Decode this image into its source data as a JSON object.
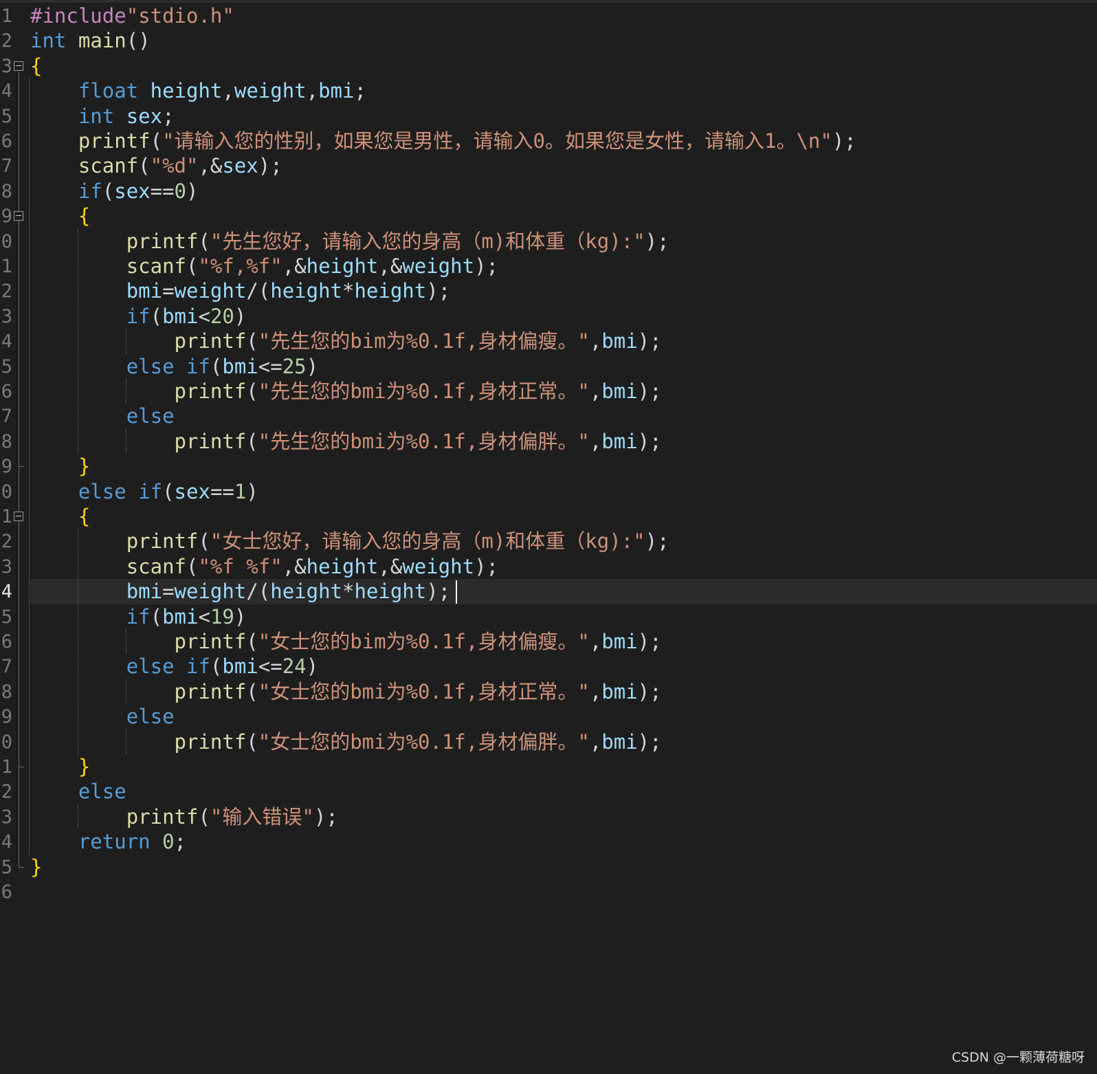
{
  "editor": {
    "current_line": 24,
    "lines": [
      {
        "num": "1",
        "tokens": [
          [
            "pp",
            "#include"
          ],
          [
            "str",
            "\"stdio.h\""
          ]
        ]
      },
      {
        "num": "2",
        "tokens": [
          [
            "kw",
            "int"
          ],
          [
            "pn",
            " "
          ],
          [
            "fn",
            "main"
          ],
          [
            "pn",
            "()"
          ]
        ]
      },
      {
        "num": "3",
        "tokens": [
          [
            "br",
            "{"
          ]
        ]
      },
      {
        "num": "4",
        "tokens": [
          [
            "pn",
            "    "
          ],
          [
            "kw",
            "float"
          ],
          [
            "pn",
            " "
          ],
          [
            "id",
            "height"
          ],
          [
            "pn",
            ","
          ],
          [
            "id",
            "weight"
          ],
          [
            "pn",
            ","
          ],
          [
            "id",
            "bmi"
          ],
          [
            "pn",
            ";"
          ]
        ]
      },
      {
        "num": "5",
        "tokens": [
          [
            "pn",
            "    "
          ],
          [
            "kw",
            "int"
          ],
          [
            "pn",
            " "
          ],
          [
            "id",
            "sex"
          ],
          [
            "pn",
            ";"
          ]
        ]
      },
      {
        "num": "6",
        "tokens": [
          [
            "pn",
            "    "
          ],
          [
            "fn",
            "printf"
          ],
          [
            "pn",
            "("
          ],
          [
            "str",
            "\"请输入您的性别，如果您是男性，请输入0。如果您是女性，请输入1。\\n\""
          ],
          [
            "pn",
            ");"
          ]
        ]
      },
      {
        "num": "7",
        "tokens": [
          [
            "pn",
            "    "
          ],
          [
            "fn",
            "scanf"
          ],
          [
            "pn",
            "("
          ],
          [
            "str",
            "\"%d\""
          ],
          [
            "pn",
            ",&"
          ],
          [
            "id",
            "sex"
          ],
          [
            "pn",
            ");"
          ]
        ]
      },
      {
        "num": "8",
        "tokens": [
          [
            "pn",
            "    "
          ],
          [
            "kw",
            "if"
          ],
          [
            "pn",
            "("
          ],
          [
            "id",
            "sex"
          ],
          [
            "pn",
            "=="
          ],
          [
            "num",
            "0"
          ],
          [
            "pn",
            ")"
          ]
        ]
      },
      {
        "num": "9",
        "tokens": [
          [
            "pn",
            "    "
          ],
          [
            "br",
            "{"
          ]
        ]
      },
      {
        "num": "0",
        "tokens": [
          [
            "pn",
            "        "
          ],
          [
            "fn",
            "printf"
          ],
          [
            "pn",
            "("
          ],
          [
            "str",
            "\"先生您好，请输入您的身高（m)和体重（kg):\""
          ],
          [
            "pn",
            ");"
          ]
        ]
      },
      {
        "num": "1",
        "tokens": [
          [
            "pn",
            "        "
          ],
          [
            "fn",
            "scanf"
          ],
          [
            "pn",
            "("
          ],
          [
            "str",
            "\"%f,%f\""
          ],
          [
            "pn",
            ",&"
          ],
          [
            "id",
            "height"
          ],
          [
            "pn",
            ",&"
          ],
          [
            "id",
            "weight"
          ],
          [
            "pn",
            ");"
          ]
        ]
      },
      {
        "num": "2",
        "tokens": [
          [
            "pn",
            "        "
          ],
          [
            "id",
            "bmi"
          ],
          [
            "pn",
            "="
          ],
          [
            "id",
            "weight"
          ],
          [
            "pn",
            "/("
          ],
          [
            "id",
            "height"
          ],
          [
            "pn",
            "*"
          ],
          [
            "id",
            "height"
          ],
          [
            "pn",
            ");"
          ]
        ]
      },
      {
        "num": "3",
        "tokens": [
          [
            "pn",
            "        "
          ],
          [
            "kw",
            "if"
          ],
          [
            "pn",
            "("
          ],
          [
            "id",
            "bmi"
          ],
          [
            "pn",
            "<"
          ],
          [
            "num",
            "20"
          ],
          [
            "pn",
            ")"
          ]
        ]
      },
      {
        "num": "4",
        "tokens": [
          [
            "pn",
            "            "
          ],
          [
            "fn",
            "printf"
          ],
          [
            "pn",
            "("
          ],
          [
            "str",
            "\"先生您的bim为%0.1f,身材偏瘦。\""
          ],
          [
            "pn",
            ","
          ],
          [
            "id",
            "bmi"
          ],
          [
            "pn",
            ");"
          ]
        ]
      },
      {
        "num": "5",
        "tokens": [
          [
            "pn",
            "        "
          ],
          [
            "kw",
            "else"
          ],
          [
            "pn",
            " "
          ],
          [
            "kw",
            "if"
          ],
          [
            "pn",
            "("
          ],
          [
            "id",
            "bmi"
          ],
          [
            "pn",
            "<="
          ],
          [
            "num",
            "25"
          ],
          [
            "pn",
            ")"
          ]
        ]
      },
      {
        "num": "6",
        "tokens": [
          [
            "pn",
            "            "
          ],
          [
            "fn",
            "printf"
          ],
          [
            "pn",
            "("
          ],
          [
            "str",
            "\"先生您的bmi为%0.1f,身材正常。\""
          ],
          [
            "pn",
            ","
          ],
          [
            "id",
            "bmi"
          ],
          [
            "pn",
            ");"
          ]
        ]
      },
      {
        "num": "7",
        "tokens": [
          [
            "pn",
            "        "
          ],
          [
            "kw",
            "else"
          ]
        ]
      },
      {
        "num": "8",
        "tokens": [
          [
            "pn",
            "            "
          ],
          [
            "fn",
            "printf"
          ],
          [
            "pn",
            "("
          ],
          [
            "str",
            "\"先生您的bmi为%0.1f,身材偏胖。\""
          ],
          [
            "pn",
            ","
          ],
          [
            "id",
            "bmi"
          ],
          [
            "pn",
            ");"
          ]
        ]
      },
      {
        "num": "9",
        "tokens": [
          [
            "pn",
            "    "
          ],
          [
            "br",
            "}"
          ]
        ]
      },
      {
        "num": "0",
        "tokens": [
          [
            "pn",
            "    "
          ],
          [
            "kw",
            "else"
          ],
          [
            "pn",
            " "
          ],
          [
            "kw",
            "if"
          ],
          [
            "pn",
            "("
          ],
          [
            "id",
            "sex"
          ],
          [
            "pn",
            "=="
          ],
          [
            "num",
            "1"
          ],
          [
            "pn",
            ")"
          ]
        ]
      },
      {
        "num": "1",
        "tokens": [
          [
            "pn",
            "    "
          ],
          [
            "br",
            "{"
          ]
        ]
      },
      {
        "num": "2",
        "tokens": [
          [
            "pn",
            "        "
          ],
          [
            "fn",
            "printf"
          ],
          [
            "pn",
            "("
          ],
          [
            "str",
            "\"女士您好，请输入您的身高（m)和体重（kg):\""
          ],
          [
            "pn",
            ");"
          ]
        ]
      },
      {
        "num": "3",
        "tokens": [
          [
            "pn",
            "        "
          ],
          [
            "fn",
            "scanf"
          ],
          [
            "pn",
            "("
          ],
          [
            "str",
            "\"%f %f\""
          ],
          [
            "pn",
            ",&"
          ],
          [
            "id",
            "height"
          ],
          [
            "pn",
            ",&"
          ],
          [
            "id",
            "weight"
          ],
          [
            "pn",
            ");"
          ]
        ]
      },
      {
        "num": "4",
        "tokens": [
          [
            "pn",
            "        "
          ],
          [
            "id",
            "bmi"
          ],
          [
            "pn",
            "="
          ],
          [
            "id",
            "weight"
          ],
          [
            "pn",
            "/("
          ],
          [
            "id",
            "height"
          ],
          [
            "pn",
            "*"
          ],
          [
            "id",
            "height"
          ],
          [
            "pn",
            ");"
          ]
        ]
      },
      {
        "num": "5",
        "tokens": [
          [
            "pn",
            "        "
          ],
          [
            "kw",
            "if"
          ],
          [
            "pn",
            "("
          ],
          [
            "id",
            "bmi"
          ],
          [
            "pn",
            "<"
          ],
          [
            "num",
            "19"
          ],
          [
            "pn",
            ")"
          ]
        ]
      },
      {
        "num": "6",
        "tokens": [
          [
            "pn",
            "            "
          ],
          [
            "fn",
            "printf"
          ],
          [
            "pn",
            "("
          ],
          [
            "str",
            "\"女士您的bim为%0.1f,身材偏瘦。\""
          ],
          [
            "pn",
            ","
          ],
          [
            "id",
            "bmi"
          ],
          [
            "pn",
            ");"
          ]
        ]
      },
      {
        "num": "7",
        "tokens": [
          [
            "pn",
            "        "
          ],
          [
            "kw",
            "else"
          ],
          [
            "pn",
            " "
          ],
          [
            "kw",
            "if"
          ],
          [
            "pn",
            "("
          ],
          [
            "id",
            "bmi"
          ],
          [
            "pn",
            "<="
          ],
          [
            "num",
            "24"
          ],
          [
            "pn",
            ")"
          ]
        ]
      },
      {
        "num": "8",
        "tokens": [
          [
            "pn",
            "            "
          ],
          [
            "fn",
            "printf"
          ],
          [
            "pn",
            "("
          ],
          [
            "str",
            "\"女士您的bmi为%0.1f,身材正常。\""
          ],
          [
            "pn",
            ","
          ],
          [
            "id",
            "bmi"
          ],
          [
            "pn",
            ");"
          ]
        ]
      },
      {
        "num": "9",
        "tokens": [
          [
            "pn",
            "        "
          ],
          [
            "kw",
            "else"
          ]
        ]
      },
      {
        "num": "0",
        "tokens": [
          [
            "pn",
            "            "
          ],
          [
            "fn",
            "printf"
          ],
          [
            "pn",
            "("
          ],
          [
            "str",
            "\"女士您的bmi为%0.1f,身材偏胖。\""
          ],
          [
            "pn",
            ","
          ],
          [
            "id",
            "bmi"
          ],
          [
            "pn",
            ");"
          ]
        ]
      },
      {
        "num": "1",
        "tokens": [
          [
            "pn",
            "    "
          ],
          [
            "br",
            "}"
          ]
        ]
      },
      {
        "num": "2",
        "tokens": [
          [
            "pn",
            "    "
          ],
          [
            "kw",
            "else"
          ]
        ]
      },
      {
        "num": "3",
        "tokens": [
          [
            "pn",
            "        "
          ],
          [
            "fn",
            "printf"
          ],
          [
            "pn",
            "("
          ],
          [
            "str",
            "\"输入错误\""
          ],
          [
            "pn",
            ");"
          ]
        ]
      },
      {
        "num": "4",
        "tokens": [
          [
            "pn",
            "    "
          ],
          [
            "kw",
            "return"
          ],
          [
            "pn",
            " "
          ],
          [
            "num",
            "0"
          ],
          [
            "pn",
            ";"
          ]
        ]
      },
      {
        "num": "5",
        "tokens": [
          [
            "br",
            "}"
          ]
        ]
      },
      {
        "num": "6",
        "tokens": []
      }
    ]
  },
  "watermark": "CSDN @一颗薄荷糖呀",
  "colors": {
    "background": "#1e1e1e",
    "keyword": "#569cd6",
    "string": "#ce9178",
    "number": "#b5cea8",
    "identifier": "#9cdcfe",
    "function": "#dcdcaa",
    "preprocessor": "#c586c0"
  }
}
